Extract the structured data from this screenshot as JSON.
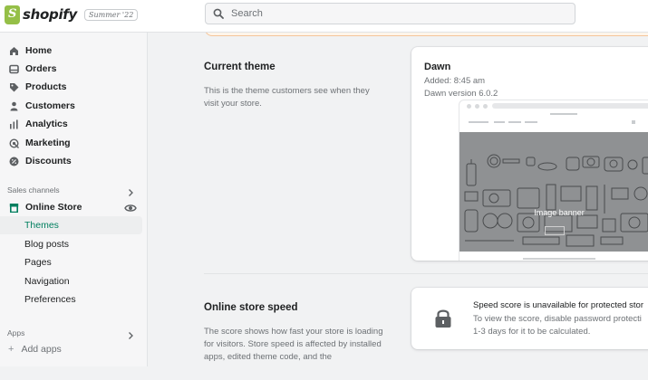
{
  "header": {
    "logo_text": "shopify",
    "edition_badge": "Summer '22",
    "search_placeholder": "Search"
  },
  "sidebar": {
    "items": [
      {
        "label": "Home",
        "icon": "home-icon"
      },
      {
        "label": "Orders",
        "icon": "orders-icon"
      },
      {
        "label": "Products",
        "icon": "tag-icon"
      },
      {
        "label": "Customers",
        "icon": "person-icon"
      },
      {
        "label": "Analytics",
        "icon": "bar-chart-icon"
      },
      {
        "label": "Marketing",
        "icon": "target-icon"
      },
      {
        "label": "Discounts",
        "icon": "discount-icon"
      }
    ],
    "sales_channels_label": "Sales channels",
    "online_store": {
      "label": "Online Store",
      "icon": "store-icon"
    },
    "online_store_sub": [
      "Themes",
      "Blog posts",
      "Pages",
      "Navigation",
      "Preferences"
    ],
    "active_sub": "Themes",
    "apps_label": "Apps",
    "add_apps_label": "Add apps"
  },
  "current_theme": {
    "title": "Current theme",
    "description": "This is the theme customers see when they visit your store.",
    "theme_name": "Dawn",
    "added": "Added: 8:45 am",
    "version": "Dawn version 6.0.2",
    "preview_caption": "Image banner"
  },
  "store_speed": {
    "title": "Online store speed",
    "description": "The score shows how fast your store is loading for visitors. Store speed is affected by installed apps, edited theme code, and the",
    "speed_title": "Speed score is unavailable for protected stor",
    "speed_line1": "To view the score, disable password protecti",
    "speed_line2": "1-3 days for it to be calculated."
  },
  "colors": {
    "accent_green": "#007f5f",
    "brand_green": "#95bf47",
    "banner_border": "#f4c59a"
  }
}
